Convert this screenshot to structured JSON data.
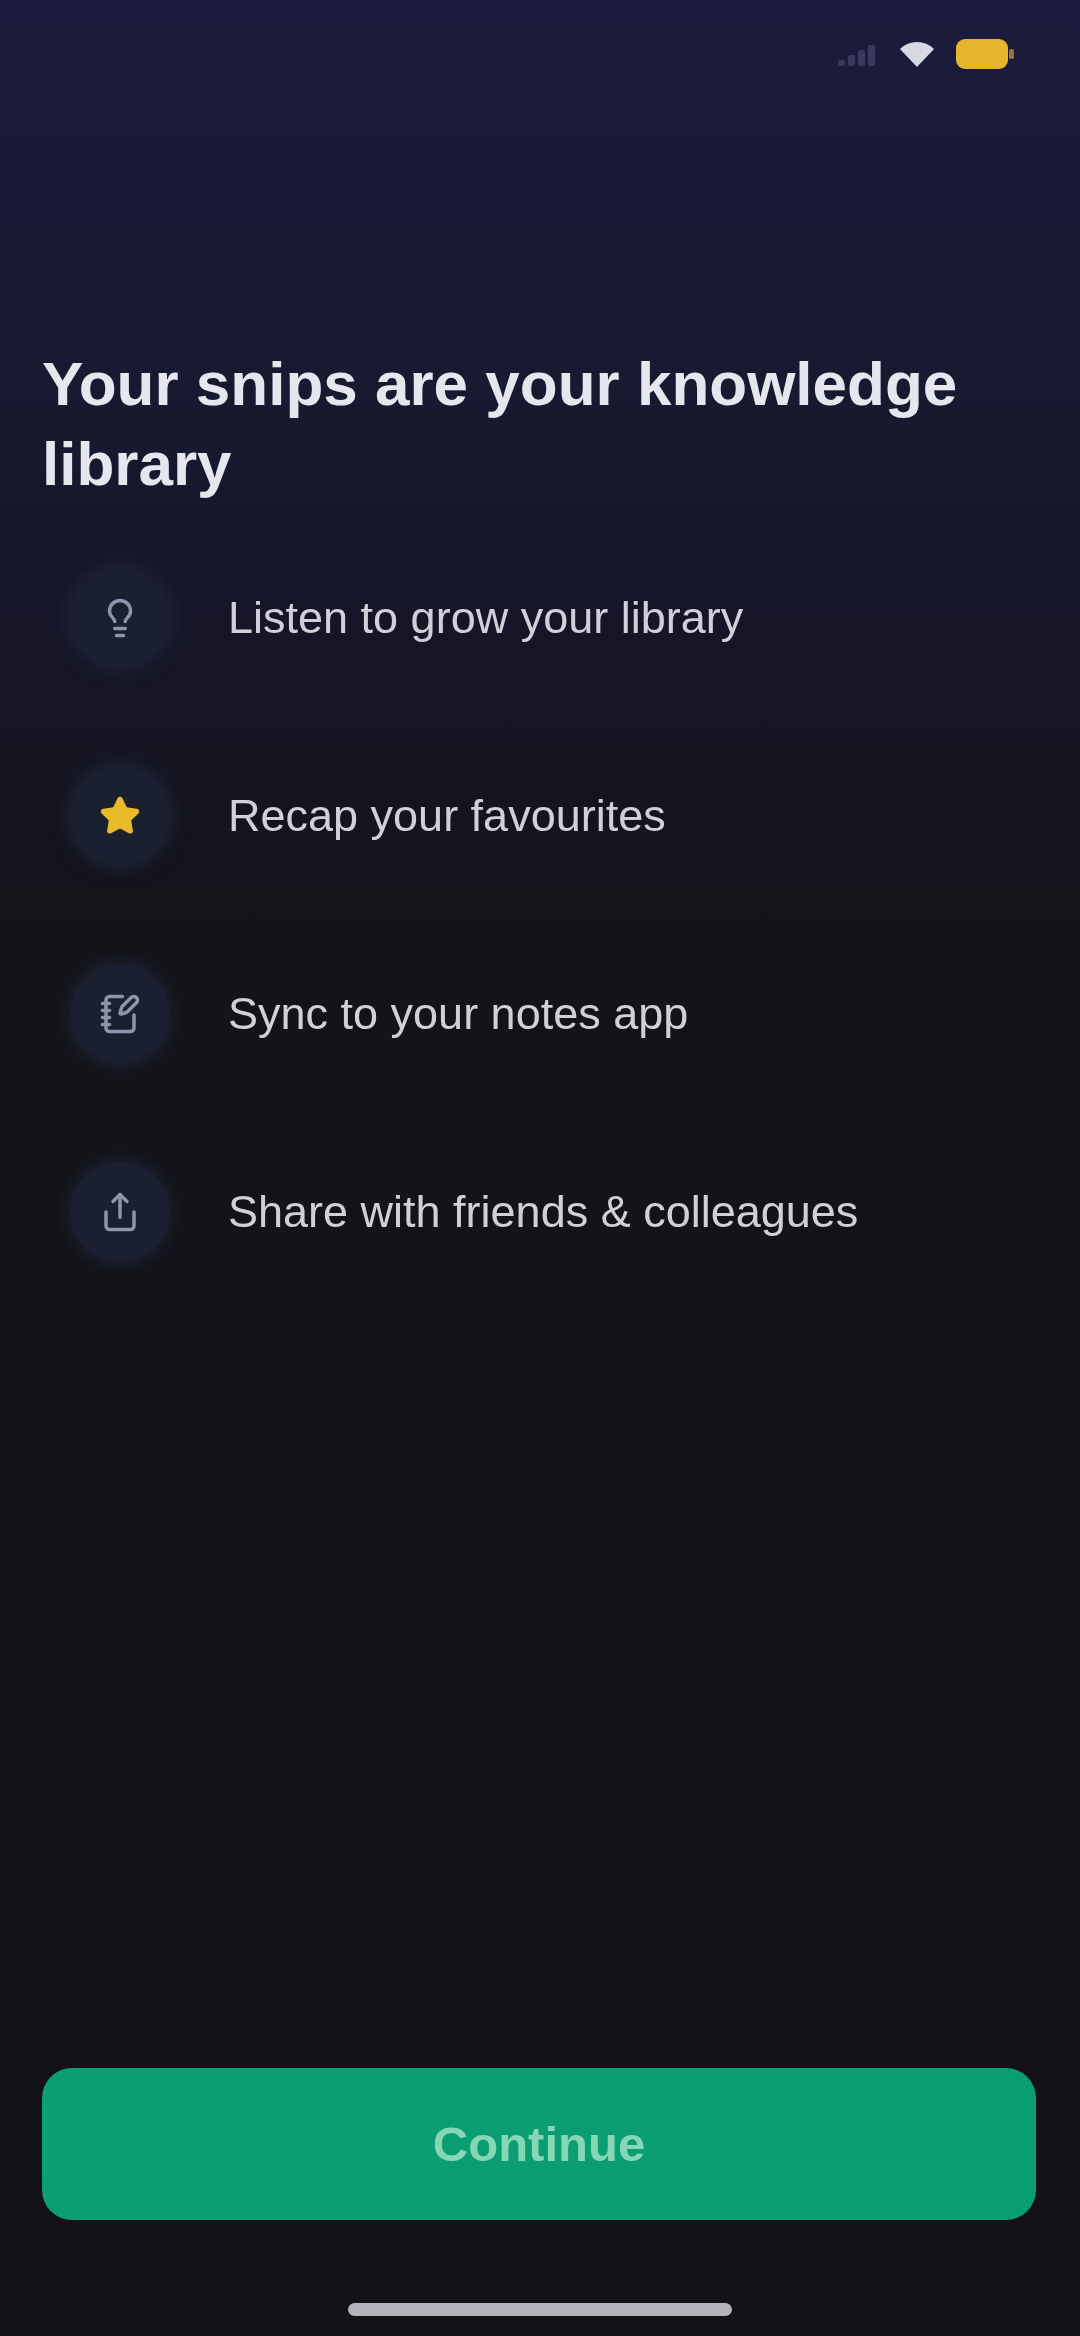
{
  "status_bar": {
    "low_power_mode": true
  },
  "heading": "Your snips are your knowledge library",
  "features": [
    {
      "label": "Listen to grow your library"
    },
    {
      "label": "Recap your favourites"
    },
    {
      "label": "Sync to your notes app"
    },
    {
      "label": "Share with friends & colleagues"
    }
  ],
  "continue_button": {
    "label": "Continue"
  }
}
